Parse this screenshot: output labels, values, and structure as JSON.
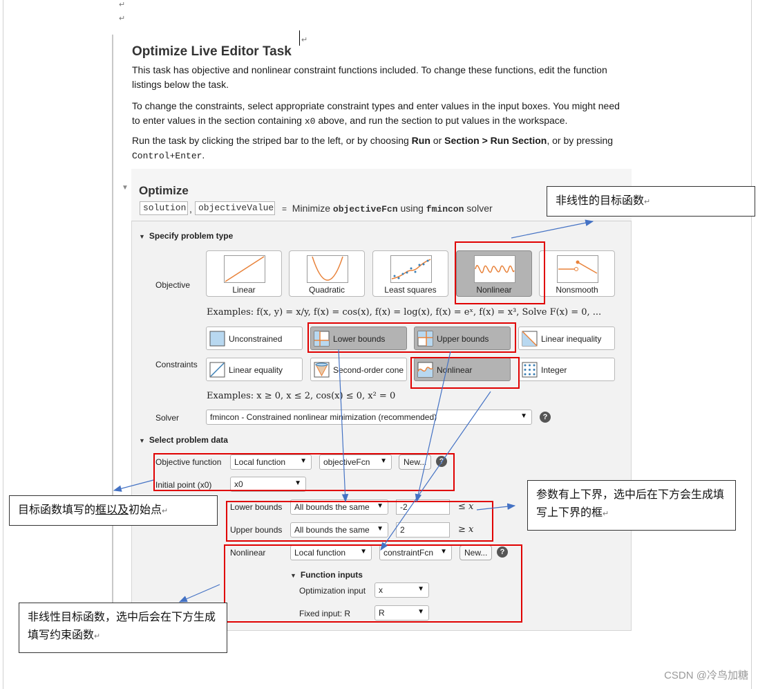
{
  "doc": {
    "title": "Optimize Live Editor Task",
    "para1": "This task has objective and nonlinear constraint functions included. To change these functions, edit the function listings below the task.",
    "para2_a": "To change the constraints, select appropriate constraint types and enter values in the input boxes. You might need to enter values in the section containing ",
    "para2_code": "x0",
    "para2_b": " above, and run the section to put values in the workspace.",
    "para3_a": "Run the task by clicking the striped bar to the left, or by choosing ",
    "para3_run": "Run",
    "para3_or": " or ",
    "para3_section": "Section > Run Section",
    "para3_b": ", or by pressing ",
    "para3_code": "Control+Enter",
    "para3_end": "."
  },
  "task": {
    "title": "Optimize",
    "out1": "solution",
    "comma": ",",
    "out2": "objectiveValue",
    "eq": "=",
    "minimize": "Minimize",
    "fcn": "objectiveFcn",
    "using": "using",
    "solver_fn": "fmincon",
    "solver_word": "solver"
  },
  "problem_type": {
    "header": "Specify problem type",
    "objective_label": "Objective",
    "objectives": [
      {
        "label": "Linear",
        "selected": false
      },
      {
        "label": "Quadratic",
        "selected": false
      },
      {
        "label": "Least squares",
        "selected": false
      },
      {
        "label": "Nonlinear",
        "selected": true
      },
      {
        "label": "Nonsmooth",
        "selected": false
      }
    ],
    "objective_examples": "Examples: f(x, y) = x/y, f(x) = cos(x), f(x) = log(x), f(x) = eˣ, f(x) = x³, Solve F(x) = 0, ...",
    "constraints_label": "Constraints",
    "constraints": [
      {
        "label": "Unconstrained",
        "selected": false
      },
      {
        "label": "Lower bounds",
        "selected": true
      },
      {
        "label": "Upper bounds",
        "selected": true
      },
      {
        "label": "Linear inequality",
        "selected": false
      },
      {
        "label": "Linear equality",
        "selected": false
      },
      {
        "label": "Second-order cone",
        "selected": false
      },
      {
        "label": "Nonlinear",
        "selected": true
      },
      {
        "label": "Integer",
        "selected": false
      }
    ],
    "constraint_examples": "Examples: x ≥ 0, x ≤ 2, cos(x) ≤ 0, x² = 0",
    "solver_label": "Solver",
    "solver_value": "fmincon - Constrained nonlinear minimization (recommended)",
    "help": "?"
  },
  "problem_data": {
    "header": "Select problem data",
    "objective_function_label": "Objective function",
    "objective_source": "Local function",
    "objective_fcn": "objectiveFcn",
    "new_label": "New...",
    "initial_point_label": "Initial point (x0)",
    "initial_point_value": "x0",
    "lower_bounds_label": "Lower bounds",
    "lower_bounds_mode": "All bounds the same",
    "lower_bounds_value": "-2",
    "lower_bounds_rel": "≤ x",
    "upper_bounds_label": "Upper bounds",
    "upper_bounds_mode": "All bounds the same",
    "upper_bounds_value": "2",
    "upper_bounds_rel": "≥ x",
    "nonlinear_label": "Nonlinear",
    "nonlinear_source": "Local function",
    "nonlinear_fcn": "constraintFcn",
    "function_inputs_header": "Function inputs",
    "optimization_input_label": "Optimization input",
    "optimization_input_value": "x",
    "fixed_input_label": "Fixed input: R",
    "fixed_input_value": "R"
  },
  "annotations": {
    "note_objective": "非线性的目标函数",
    "note_start_a": "目标函数填写的",
    "note_start_link": "框以及",
    "note_start_b": "初始点",
    "note_bounds": "参数有上下界，选中后在下方会生成填写上下界的框",
    "note_nonlinear": "非线性目标函数，选中后会在下方生成填写约束函数",
    "para_mark": "↵"
  },
  "watermark": "CSDN @冷鸟加糖",
  "colors": {
    "annotation_red": "#e00000",
    "arrow_blue": "#4472c4",
    "selected_tile": "#b3b3b3"
  }
}
